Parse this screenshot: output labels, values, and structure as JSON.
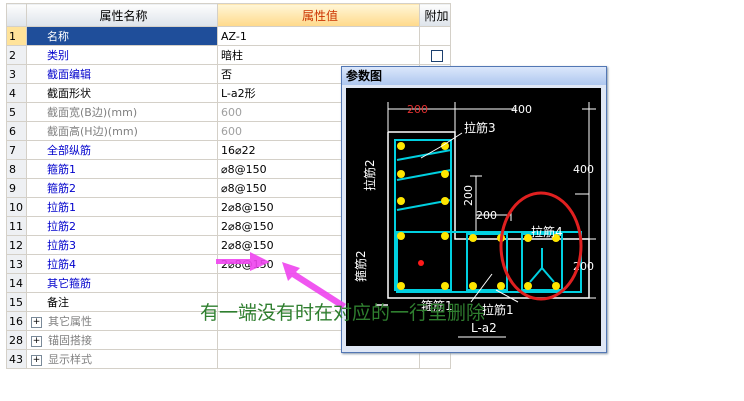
{
  "grid": {
    "headers": {
      "name": "属性名称",
      "value": "属性值",
      "extra": "附加"
    },
    "rows": [
      {
        "n": "1",
        "name": "名称",
        "value": "AZ-1"
      },
      {
        "n": "2",
        "name": "类别",
        "value": "暗柱"
      },
      {
        "n": "3",
        "name": "截面编辑",
        "value": "否"
      },
      {
        "n": "4",
        "name": "截面形状",
        "value": "L-a2形"
      },
      {
        "n": "5",
        "name": "截面宽(B边)(mm)",
        "value": "600"
      },
      {
        "n": "6",
        "name": "截面高(H边)(mm)",
        "value": "600"
      },
      {
        "n": "7",
        "name": "全部纵筋",
        "value": "16⌀22"
      },
      {
        "n": "8",
        "name": "箍筋1",
        "value": "⌀8@150"
      },
      {
        "n": "9",
        "name": "箍筋2",
        "value": "⌀8@150"
      },
      {
        "n": "10",
        "name": "拉筋1",
        "value": "2⌀8@150"
      },
      {
        "n": "11",
        "name": "拉筋2",
        "value": "2⌀8@150"
      },
      {
        "n": "12",
        "name": "拉筋3",
        "value": "2⌀8@150"
      },
      {
        "n": "13",
        "name": "拉筋4",
        "value": "2⌀8@150"
      },
      {
        "n": "14",
        "name": "其它箍筋",
        "value": ""
      },
      {
        "n": "15",
        "name": "备注",
        "value": ""
      },
      {
        "n": "16",
        "name": "其它属性",
        "value": ""
      },
      {
        "n": "28",
        "name": "锚固搭接",
        "value": ""
      },
      {
        "n": "43",
        "name": "显示样式",
        "value": ""
      }
    ]
  },
  "param_window": {
    "title": "参数图",
    "dims": {
      "d200a": "200",
      "d400a": "400",
      "d400b": "400",
      "d200b": "200",
      "d200c": "200",
      "d200d": "200"
    },
    "labels": {
      "lajin3": "拉筋3",
      "lajin2": "拉筋2",
      "lajin4": "拉筋4",
      "gujin2": "箍筋2",
      "gujin1": "箍筋1",
      "lajin1": "拉筋1",
      "shape": "L-a2"
    }
  },
  "annotation": "有一端没有时在对应的一行里删除",
  "colors": {
    "selected": "#1f4e9a",
    "header_value": "#cc3300",
    "annotation": "#2f7f2f",
    "arrow": "#ee44ee",
    "circle": "#e02020"
  }
}
